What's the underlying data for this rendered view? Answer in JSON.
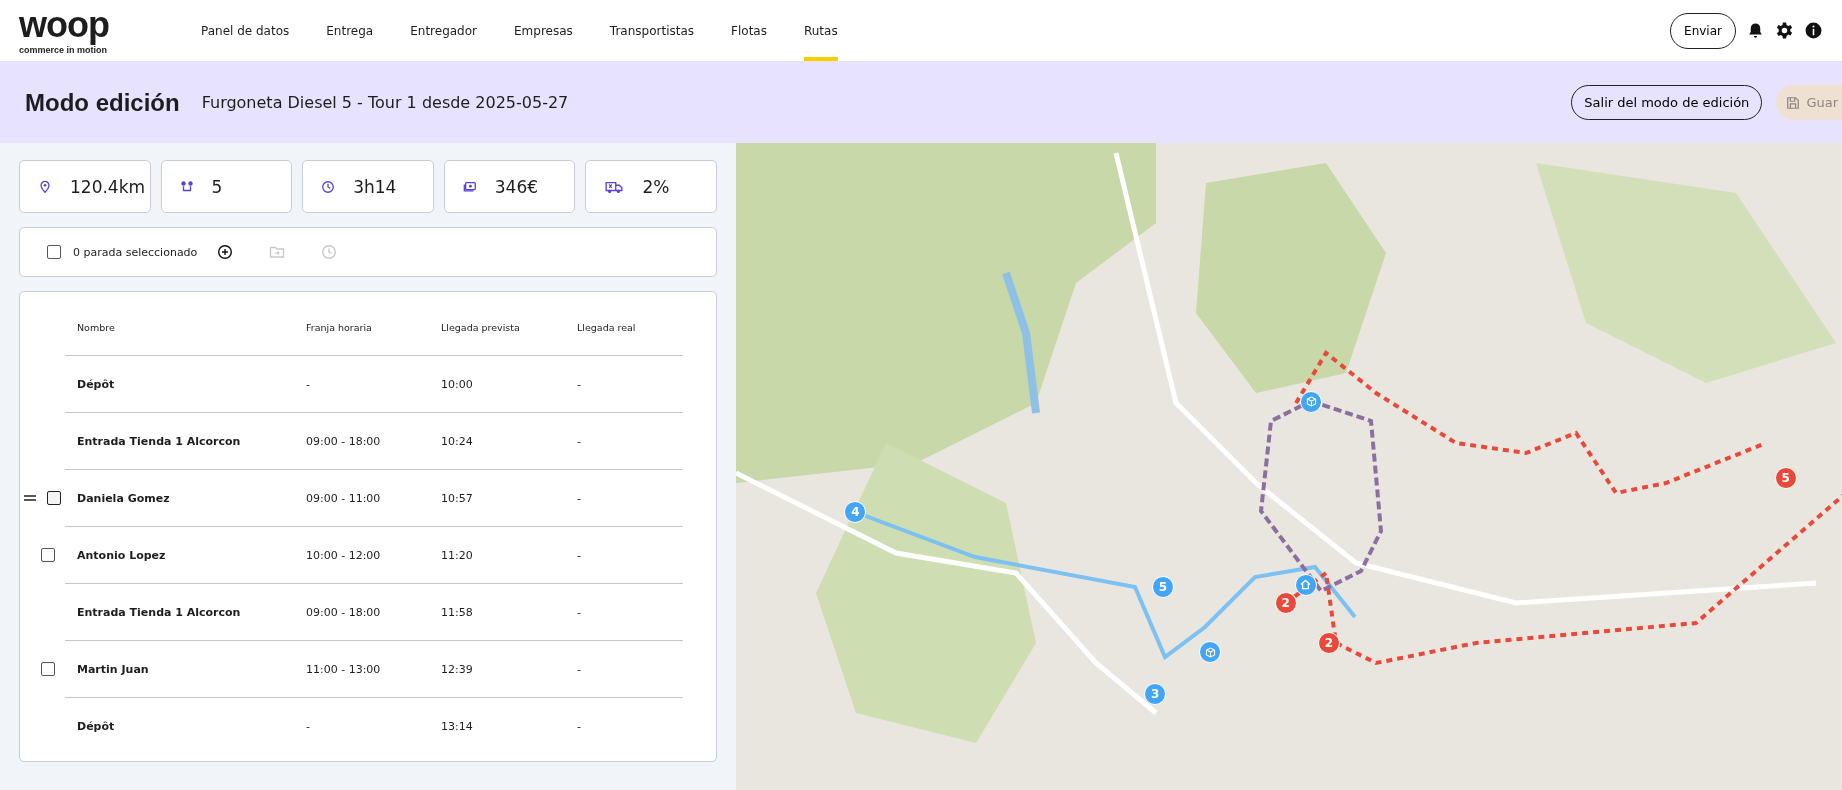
{
  "header": {
    "logo": {
      "wordmark": "woop",
      "tagline": "commerce in motion"
    },
    "nav": [
      {
        "label": "Panel de datos",
        "selected": false
      },
      {
        "label": "Entrega",
        "selected": false
      },
      {
        "label": "Entregador",
        "selected": false
      },
      {
        "label": "Empresas",
        "selected": false
      },
      {
        "label": "Transportistas",
        "selected": false
      },
      {
        "label": "Flotas",
        "selected": false
      },
      {
        "label": "Rutas",
        "selected": true
      }
    ],
    "send_button": "Enviar"
  },
  "edit_bar": {
    "title": "Modo edición",
    "subtitle": "Furgoneta Diesel 5 - Tour 1 desde 2025-05-27",
    "exit_button": "Salir del modo de edición",
    "save_button": {
      "label": "Guar",
      "disabled": true
    }
  },
  "stats": [
    {
      "kind": "distance",
      "value": "120.4km"
    },
    {
      "kind": "stops",
      "value": "5"
    },
    {
      "kind": "time",
      "value": "3h14"
    },
    {
      "kind": "cost",
      "value": "346€"
    },
    {
      "kind": "load",
      "value": "2%"
    }
  ],
  "selection_bar": {
    "checked": false,
    "label": "0 parada seleccionado"
  },
  "table": {
    "columns": [
      "Nombre",
      "Franja horaria",
      "Llegada prevista",
      "Llegada real"
    ],
    "rows": [
      {
        "kind": "depot",
        "name": "Dépôt",
        "window": "-",
        "planned": "10:00",
        "actual": "-"
      },
      {
        "kind": "depot",
        "name": "Entrada Tienda 1 Alcorcon",
        "window": "09:00 - 18:00",
        "planned": "10:24",
        "actual": "-"
      },
      {
        "kind": "stop",
        "checked": false,
        "drag_handle": true,
        "name": "Daniela Gomez",
        "window": "09:00 - 11:00",
        "planned": "10:57",
        "actual": "-"
      },
      {
        "kind": "stop",
        "checked": false,
        "drag_handle": false,
        "name": "Antonio Lopez",
        "window": "10:00 - 12:00",
        "planned": "11:20",
        "actual": "-"
      },
      {
        "kind": "depot",
        "name": "Entrada Tienda 1 Alcorcon",
        "window": "09:00 - 18:00",
        "planned": "11:58",
        "actual": "-"
      },
      {
        "kind": "stop",
        "checked": false,
        "drag_handle": false,
        "name": "Martin Juan",
        "window": "11:00 - 13:00",
        "planned": "12:39",
        "actual": "-"
      },
      {
        "kind": "depot",
        "name": "Dépôt",
        "window": "-",
        "planned": "13:14",
        "actual": "-"
      }
    ]
  },
  "map_markers": [
    {
      "kind": "number",
      "label": "4",
      "color": "#42a5f5"
    },
    {
      "kind": "number",
      "label": "5",
      "color": "#42a5f5"
    },
    {
      "kind": "number",
      "label": "3",
      "color": "#42a5f5"
    },
    {
      "kind": "number",
      "label": "2",
      "color": "#e8493b"
    },
    {
      "kind": "number",
      "label": "2",
      "color": "#e8493b"
    },
    {
      "kind": "number",
      "label": "5",
      "color": "#e8493b"
    },
    {
      "kind": "package",
      "color": "#42a5f5"
    },
    {
      "kind": "package",
      "color": "#42a5f5"
    },
    {
      "kind": "home",
      "color": "#42a5f5"
    }
  ]
}
